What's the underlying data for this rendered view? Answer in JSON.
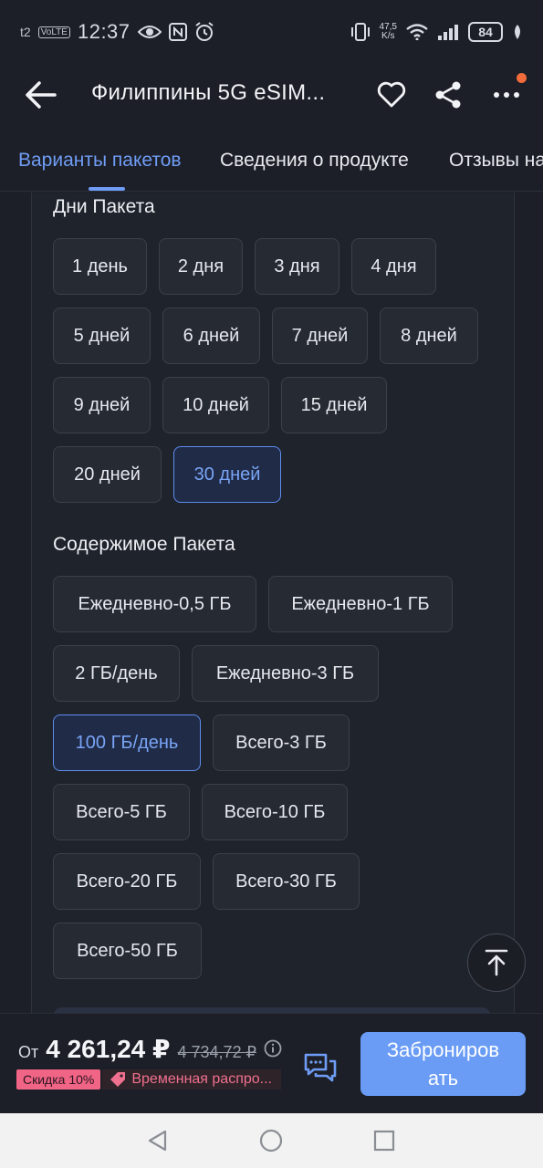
{
  "status_bar": {
    "carrier": "t2",
    "volte": "VoLTE",
    "time": "12:37",
    "net_speed_value": "47,5",
    "net_speed_unit": "K/s",
    "battery": "84"
  },
  "header": {
    "title": "Филиппины 5G eSIM...",
    "notification_color": "#f26b3a"
  },
  "tabs": [
    {
      "label": "Варианты пакетов",
      "active": true
    },
    {
      "label": "Сведения о продукте",
      "active": false
    },
    {
      "label": "Отзывы на",
      "active": false
    }
  ],
  "days_section": {
    "title": "Дни Пакета",
    "options": [
      "1 день",
      "2 дня",
      "3 дня",
      "4 дня",
      "5 дней",
      "6 дней",
      "7 дней",
      "8 дней",
      "9 дней",
      "10 дней",
      "15 дней",
      "20 дней",
      "30 дней"
    ],
    "selected": "30 дней"
  },
  "content_section": {
    "title": "Содержимое Пакета",
    "options": [
      "Ежедневно-0,5 ГБ",
      "Ежедневно-1 ГБ",
      "2 ГБ/день",
      "Ежедневно-3 ГБ",
      "100 ГБ/день",
      "Всего-3 ГБ",
      "Всего-5 ГБ",
      "Всего-10 ГБ",
      "Всего-20 ГБ",
      "Всего-30 ГБ",
      "Всего-50 ГБ"
    ],
    "selected": "100 ГБ/день"
  },
  "bottom_bar": {
    "price_prefix": "От",
    "price": "4 261,24 ₽",
    "old_price": "4 734,72 ₽",
    "discount_badge": "Скидка 10%",
    "promo_text": "Временная распро...",
    "book_button": "Забронировать",
    "book_line1": "Заброниров",
    "book_line2": "ать"
  },
  "colors": {
    "accent": "#6a9cf6",
    "selected_border": "#5f8def",
    "discount": "#f06485",
    "background": "#1c1f27"
  }
}
